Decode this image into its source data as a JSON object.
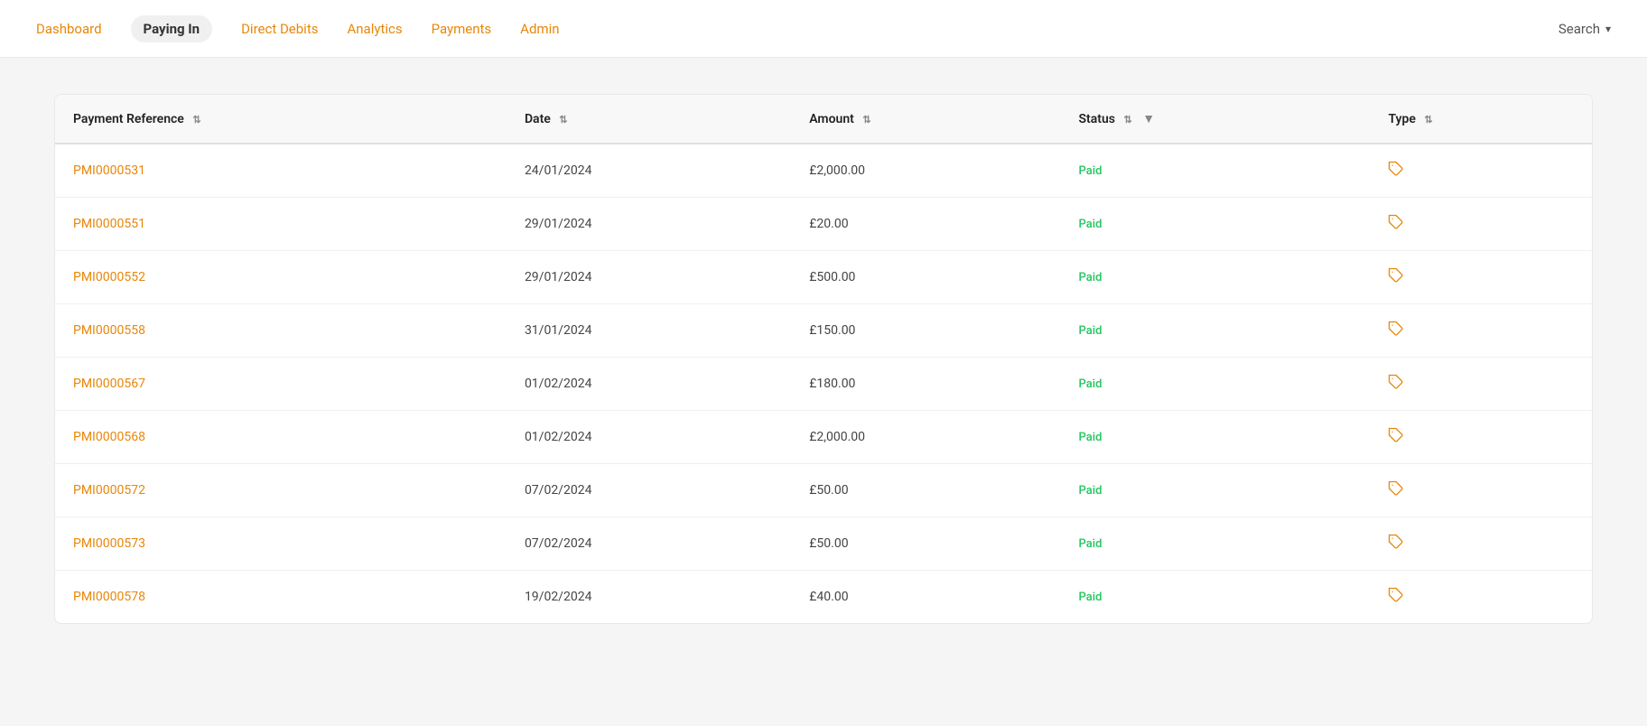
{
  "navbar": {
    "items": [
      {
        "label": "Dashboard",
        "active": false
      },
      {
        "label": "Paying In",
        "active": true
      },
      {
        "label": "Direct Debits",
        "active": false
      },
      {
        "label": "Analytics",
        "active": false
      },
      {
        "label": "Payments",
        "active": false
      },
      {
        "label": "Admin",
        "active": false
      }
    ],
    "search_label": "Search",
    "search_arrow": "▾"
  },
  "table": {
    "columns": [
      {
        "key": "payment_reference",
        "label": "Payment Reference",
        "sortable": true
      },
      {
        "key": "date",
        "label": "Date",
        "sortable": true
      },
      {
        "key": "amount",
        "label": "Amount",
        "sortable": true
      },
      {
        "key": "status",
        "label": "Status",
        "sortable": true,
        "has_filter": true
      },
      {
        "key": "type",
        "label": "Type",
        "sortable": true
      }
    ],
    "rows": [
      {
        "payment_reference": "PMI0000531",
        "date": "24/01/2024",
        "amount": "£2,000.00",
        "status": "Paid",
        "type": "🔖"
      },
      {
        "payment_reference": "PMI0000551",
        "date": "29/01/2024",
        "amount": "£20.00",
        "status": "Paid",
        "type": "🔖"
      },
      {
        "payment_reference": "PMI0000552",
        "date": "29/01/2024",
        "amount": "£500.00",
        "status": "Paid",
        "type": "🔖"
      },
      {
        "payment_reference": "PMI0000558",
        "date": "31/01/2024",
        "amount": "£150.00",
        "status": "Paid",
        "type": "🔖"
      },
      {
        "payment_reference": "PMI0000567",
        "date": "01/02/2024",
        "amount": "£180.00",
        "status": "Paid",
        "type": "🔖"
      },
      {
        "payment_reference": "PMI0000568",
        "date": "01/02/2024",
        "amount": "£2,000.00",
        "status": "Paid",
        "type": "🔖"
      },
      {
        "payment_reference": "PMI0000572",
        "date": "07/02/2024",
        "amount": "£50.00",
        "status": "Paid",
        "type": "🔖"
      },
      {
        "payment_reference": "PMI0000573",
        "date": "07/02/2024",
        "amount": "£50.00",
        "status": "Paid",
        "type": "🔖"
      },
      {
        "payment_reference": "PMI0000578",
        "date": "19/02/2024",
        "amount": "£40.00",
        "status": "Paid",
        "type": "🔖"
      }
    ]
  },
  "colors": {
    "accent": "#e8870a",
    "green": "#22c55e",
    "nav_active_bg": "#f0f0f0"
  }
}
